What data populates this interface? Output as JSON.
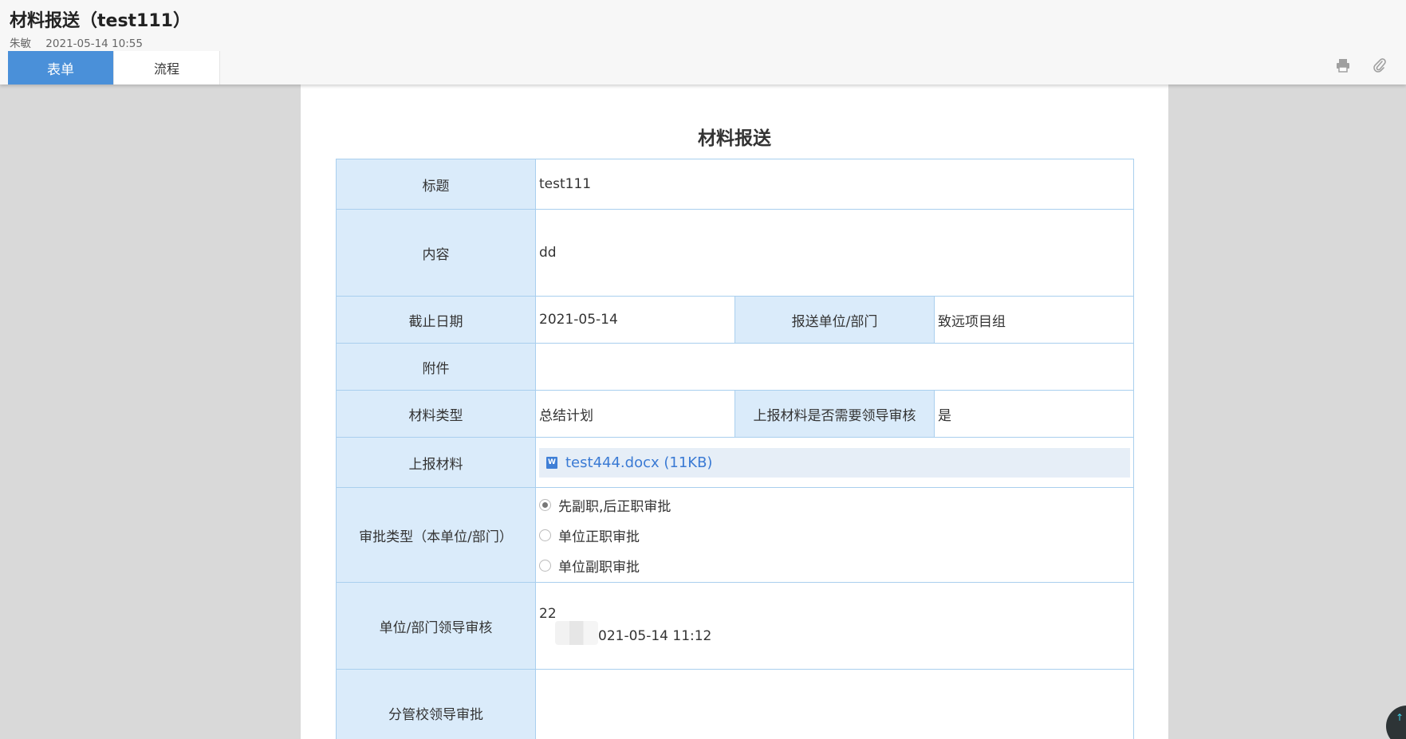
{
  "header": {
    "title": "材料报送（test111）",
    "author": "朱敏",
    "datetime": "2021-05-14 10:55",
    "tabs": [
      {
        "label": "表单",
        "active": true
      },
      {
        "label": "流程",
        "active": false
      }
    ],
    "tools": [
      {
        "icon": "print-icon"
      },
      {
        "icon": "paperclip-icon"
      }
    ]
  },
  "form": {
    "title": "材料报送",
    "fields": {
      "title_label": "标题",
      "title_value": "test111",
      "content_label": "内容",
      "content_value": "dd",
      "deadline_label": "截止日期",
      "deadline_value": "2021-05-14",
      "dept_label": "报送单位/部门",
      "dept_value": "致远项目组",
      "attachment_label": "附件",
      "attachment_value": "",
      "material_type_label": "材料类型",
      "material_type_value": "总结计划",
      "need_review_label": "上报材料是否需要领导审核",
      "need_review_value": "是",
      "report_material_label": "上报材料",
      "report_material_file": "test444.docx (11KB)",
      "approval_type_label": "审批类型（本单位/部门）",
      "approval_options": [
        {
          "label": "先副职,后正职审批",
          "checked": true
        },
        {
          "label": "单位正职审批",
          "checked": false
        },
        {
          "label": "单位副职审批",
          "checked": false
        }
      ],
      "leader_review_label": "单位/部门领导审核",
      "leader_review_comment": "22",
      "leader_review_time": "021-05-14 11:12",
      "branch_leader_label": "分管校领导审批",
      "branch_leader_value": ""
    }
  },
  "colors": {
    "tab_active": "#4a90d9",
    "label_bg": "#daebfa",
    "border": "#a9cfee",
    "link": "#3a7ad4"
  }
}
